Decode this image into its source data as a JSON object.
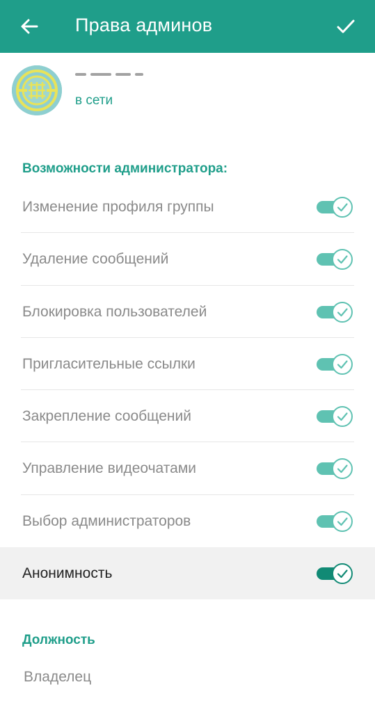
{
  "colors": {
    "accent": "#1f9e8a",
    "accent_dark": "#118a75",
    "track": "#5fc2b2"
  },
  "appbar": {
    "title": "Права админов",
    "back_icon": "arrow-left-icon",
    "done_icon": "check-icon"
  },
  "profile": {
    "status": "в сети"
  },
  "sections": {
    "admin_rights": "Возможности администратора:",
    "position": "Должность"
  },
  "permissions": [
    {
      "label": "Изменение профиля группы",
      "enabled": true
    },
    {
      "label": "Удаление сообщений",
      "enabled": true
    },
    {
      "label": "Блокировка пользователей",
      "enabled": true
    },
    {
      "label": "Пригласительные ссылки",
      "enabled": true
    },
    {
      "label": "Закрепление сообщений",
      "enabled": true
    },
    {
      "label": "Управление видеочатами",
      "enabled": true
    },
    {
      "label": "Выбор администраторов",
      "enabled": true
    },
    {
      "label": "Анонимность",
      "enabled": true
    }
  ],
  "position_value": "Владелец"
}
